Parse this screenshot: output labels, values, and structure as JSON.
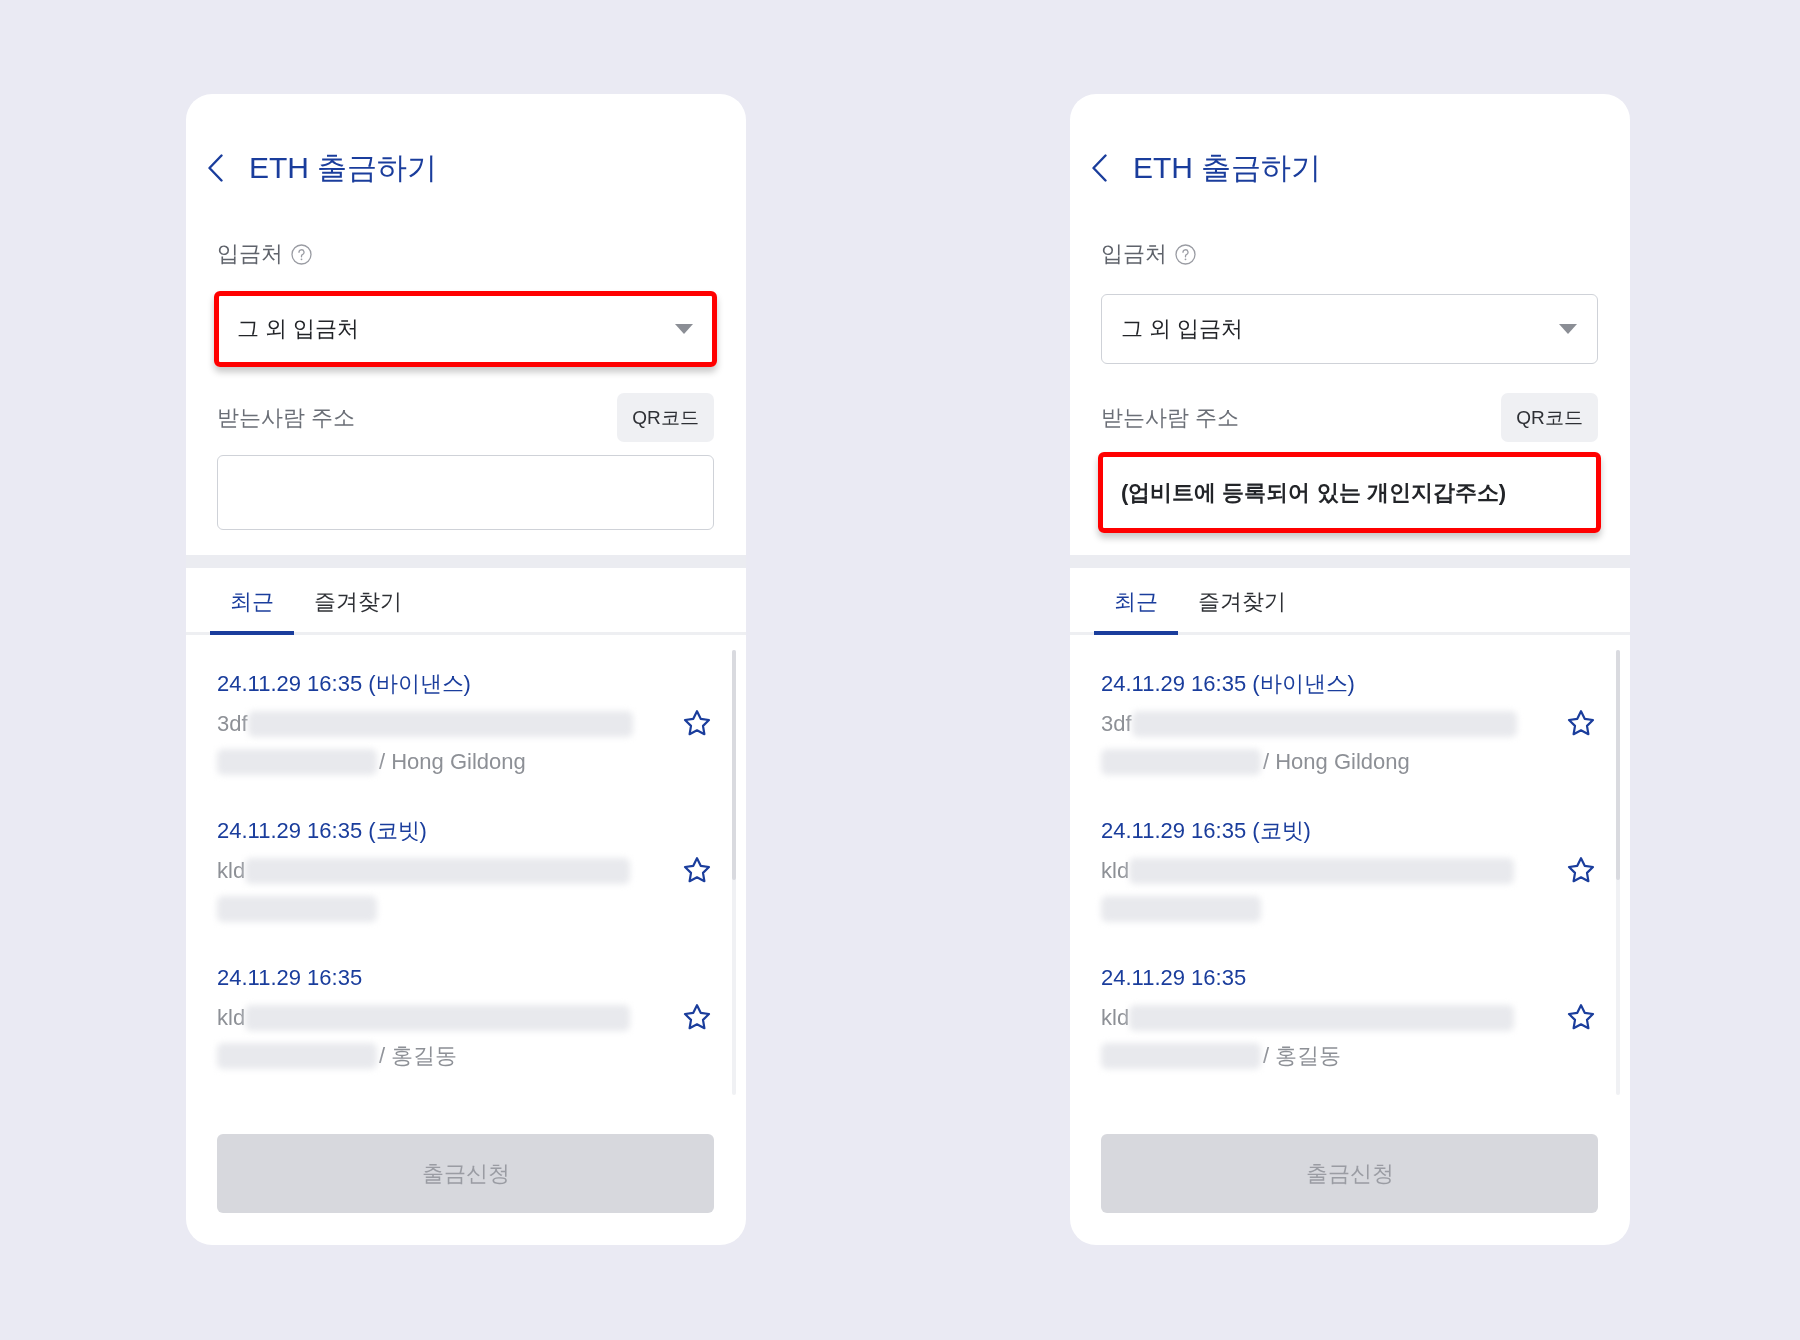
{
  "panels": [
    {
      "header": {
        "title": "ETH 출금하기"
      },
      "destination": {
        "label": "입금처",
        "value": "그 외 입금처",
        "highlighted": true
      },
      "recipient_address": {
        "label": "받는사람 주소",
        "qr_button": "QR코드",
        "highlighted": false
      },
      "tabs": [
        {
          "label": "최근",
          "selected": true
        },
        {
          "label": "즐겨찾기",
          "selected": false
        }
      ],
      "recent_addresses": [
        {
          "date": "24.11.29 16:35 (바이낸스)",
          "address_start": "3df",
          "owner": "/ Hong Gildong",
          "starred": false
        },
        {
          "date": "24.11.29 16:35 (코빗)",
          "address_start": "kld",
          "starred": false
        },
        {
          "date": "24.11.29 16:35",
          "address_start": "kld",
          "owner": "/ 홍길동",
          "starred": false
        }
      ],
      "submit_button": {
        "label": "출금신청",
        "disabled": true
      }
    },
    {
      "header": {
        "title": "ETH 출금하기"
      },
      "destination": {
        "label": "입금처",
        "value": "그 외 입금처",
        "highlighted": false
      },
      "recipient_address": {
        "label": "받는사람 주소",
        "qr_button": "QR코드",
        "value": "(업비트에 등록되어 있는 개인지갑주소)",
        "highlighted": true
      },
      "tabs": [
        {
          "label": "최근",
          "selected": true
        },
        {
          "label": "즐겨찾기",
          "selected": false
        }
      ],
      "recent_addresses": [
        {
          "date": "24.11.29 16:35 (바이낸스)",
          "address_start": "3df",
          "owner": "/ Hong Gildong",
          "starred": false
        },
        {
          "date": "24.11.29 16:35 (코빗)",
          "address_start": "kld",
          "starred": false
        },
        {
          "date": "24.11.29 16:35",
          "address_start": "kld",
          "owner": "/ 홍길동",
          "starred": false
        }
      ],
      "submit_button": {
        "label": "출금신청",
        "disabled": true
      }
    }
  ]
}
